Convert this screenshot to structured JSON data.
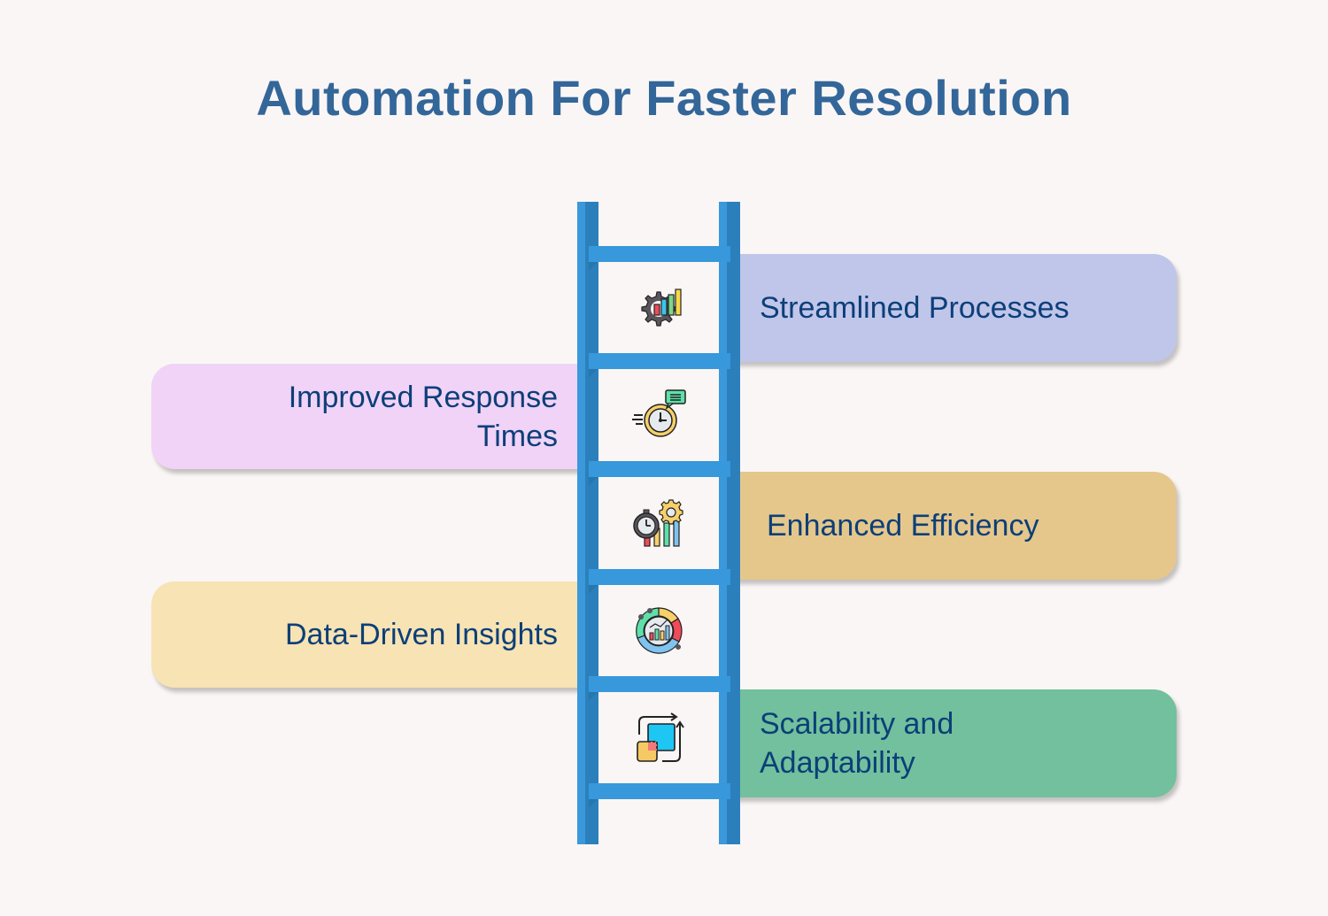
{
  "title": "Automation For Faster Resolution",
  "colors": {
    "background": "#faf6f5",
    "title": "#336699",
    "text": "#0c3f78",
    "ladder_light": "#3a98db",
    "ladder_dark": "#2b80bc"
  },
  "steps": [
    {
      "label": "Streamlined Processes",
      "side": "right",
      "color": "#c0c5ea",
      "icon": "gear-chart-icon"
    },
    {
      "label": "Improved Response Times",
      "side": "left",
      "color": "#f0d3f7",
      "icon": "stopwatch-message-icon"
    },
    {
      "label": "Enhanced Efficiency",
      "side": "right",
      "color": "#e5c78c",
      "icon": "stopwatch-gear-chart-icon"
    },
    {
      "label": "Data-Driven Insights",
      "side": "left",
      "color": "#f7e3b3",
      "icon": "analytics-dashboard-icon"
    },
    {
      "label": "Scalability and Adaptability",
      "side": "right",
      "color": "#72c09d",
      "icon": "scale-squares-icon"
    }
  ]
}
